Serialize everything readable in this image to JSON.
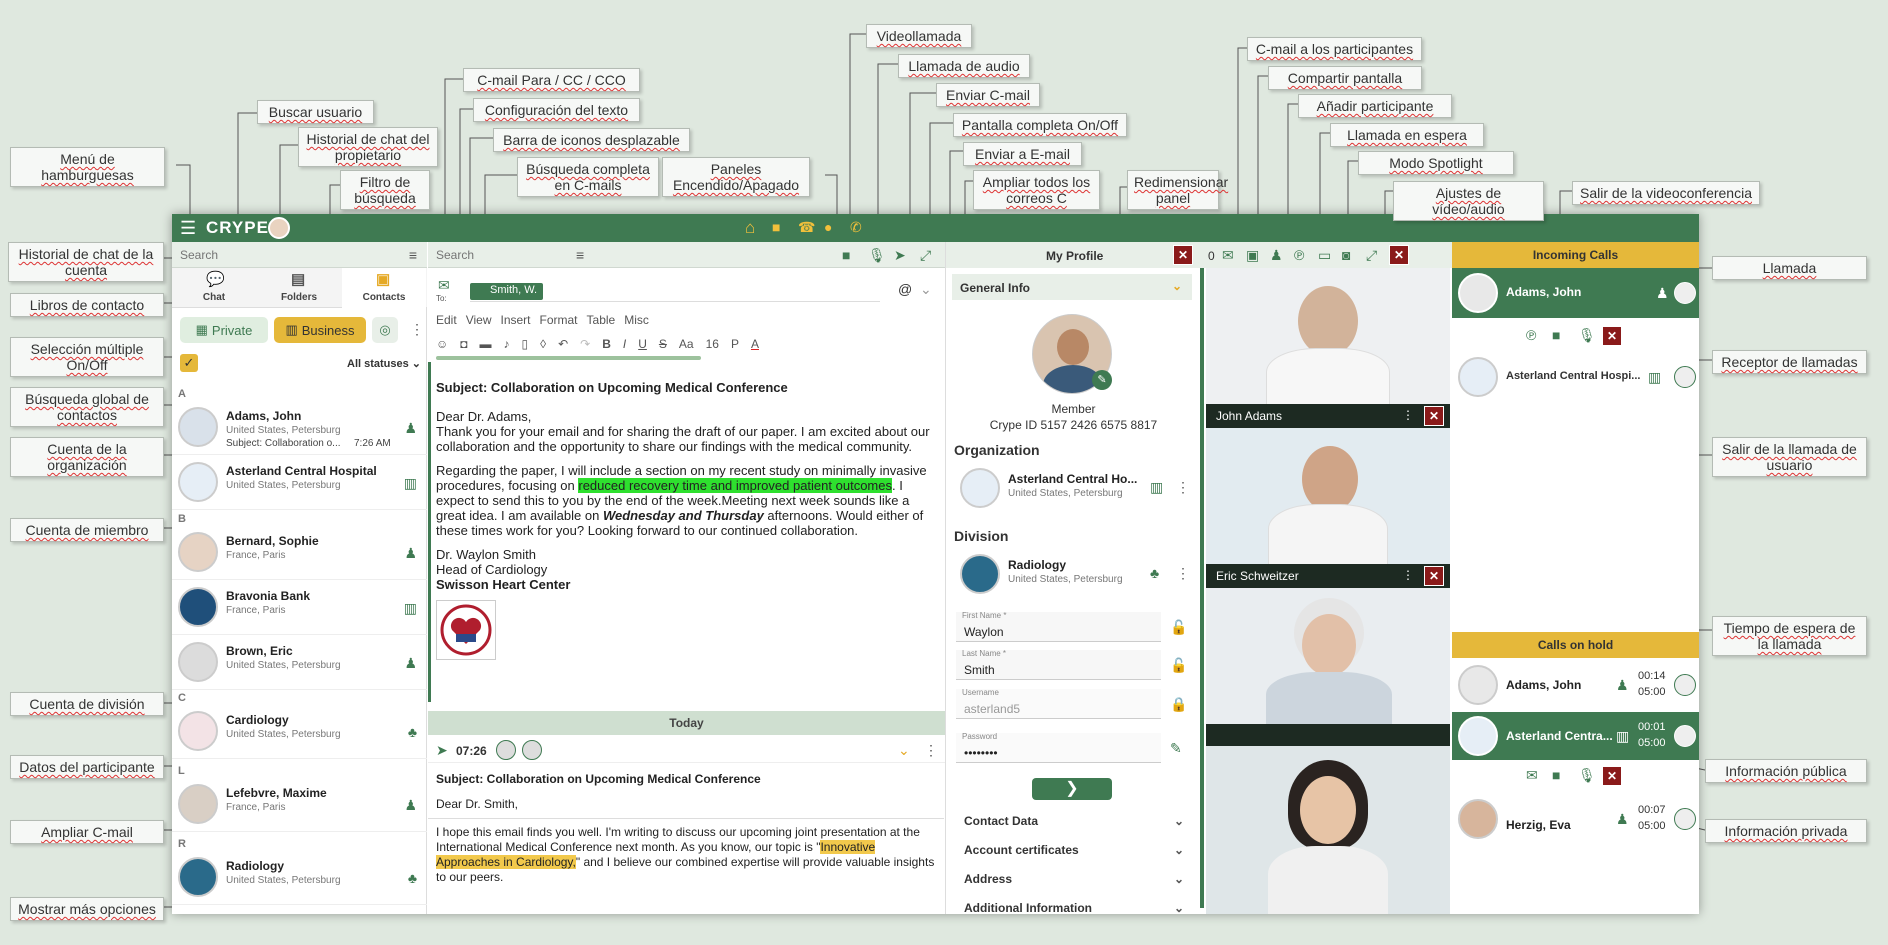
{
  "app": {
    "logo": "CRYPE",
    "left_search_placeholder": "Search",
    "mid_search_placeholder": "Search",
    "tabs": [
      "Chat",
      "Folders",
      "Contacts"
    ],
    "filters": {
      "private": "Private",
      "business": "Business",
      "statuses": "All statuses"
    },
    "sections": [
      "A",
      "B",
      "C",
      "L",
      "R"
    ],
    "contacts": [
      {
        "name": "Adams, John",
        "location": "United States, Petersburg",
        "preview": "Subject: Collaboration o...",
        "time": "7:26 AM",
        "type": "person-icon"
      },
      {
        "name": "Asterland Central Hospital",
        "location": "United States, Petersburg",
        "type": "organization-icon"
      },
      {
        "name": "Bernard, Sophie",
        "location": "France, Paris",
        "type": "person-icon"
      },
      {
        "name": "Bravonia Bank",
        "location": "France, Paris",
        "type": "organization-icon"
      },
      {
        "name": "Brown, Eric",
        "location": "United States, Petersburg",
        "type": "person-icon"
      },
      {
        "name": "Cardiology",
        "location": "United States, Petersburg",
        "type": "division-icon"
      },
      {
        "name": "Lefebvre, Maxime",
        "location": "France, Paris",
        "type": "person-icon"
      },
      {
        "name": "Radiology",
        "location": "United States, Petersburg",
        "type": "division-icon"
      }
    ],
    "compose": {
      "to_label": "To:",
      "recipient": "Smith, W.",
      "menus": [
        "Edit",
        "View",
        "Insert",
        "Format",
        "Table",
        "Misc"
      ],
      "font_size": "16",
      "paragraph": "P",
      "subject": "Subject: Collaboration on Upcoming Medical Conference",
      "greeting": "Dear Dr. Adams,",
      "p1": "Thank you for your email and for sharing the draft of our paper. I am excited about our collaboration and the opportunity to share our findings with the medical community.",
      "p2_a": "Regarding the paper, I will include a section on my recent study on minimally invasive procedures, focusing on ",
      "p2_hl": "reduced recovery time and improved patient outcomes",
      "p2_b": ". I expect to send this to you by the end of the week.Meeting next week sounds like a great idea. I am available on ",
      "p2_em": "Wednesday and Thursday",
      "p2_c": " afternoons. Would either of these times work for you? Looking forward to our continued collaboration.",
      "sig_name": "Dr. Waylon Smith",
      "sig_title": "Head of Cardiology",
      "sig_org": "Swisson Heart Center"
    },
    "thread": {
      "day": "Today",
      "time": "07:26",
      "subject": "Subject: Collaboration on Upcoming Medical Conference",
      "greeting": "Dear Dr. Smith,",
      "body_a": "I hope this email finds you well. I'm writing to discuss our upcoming joint presentation at the International Medical Conference next month. As you know, our topic is \"",
      "body_hl": "Innovative Approaches in Cardiology,",
      "body_b": "\" and I believe our combined expertise will provide valuable insights to our peers."
    },
    "profile": {
      "title": "My Profile",
      "section": "General Info",
      "role": "Member",
      "crype_id": "Crype ID 5157 2426 6575 8817",
      "org_heading": "Organization",
      "org_name": "Asterland Central Ho...",
      "org_loc": "United States, Petersburg",
      "div_heading": "Division",
      "div_name": "Radiology",
      "div_loc": "United States, Petersburg",
      "first_name_label": "First Name *",
      "first_name": "Waylon",
      "last_name_label": "Last Name *",
      "last_name": "Smith",
      "username_label": "Username",
      "username": "asterland5",
      "password_label": "Password",
      "password": "••••••••",
      "accordions": [
        "Contact Data",
        "Account certificates",
        "Address",
        "Additional Information"
      ]
    },
    "video": {
      "participant_count": "0",
      "tiles": [
        "John Adams",
        "Eric Schweitzer"
      ]
    },
    "calls": {
      "incoming_title": "Incoming Calls",
      "incoming_caller": "Adams, John",
      "incoming_receiver": "Asterland Central Hospi...",
      "hold_title": "Calls on hold",
      "hold": [
        {
          "name": "Adams, John",
          "t1": "00:14",
          "t2": "05:00"
        },
        {
          "name": "Asterland Centra...",
          "t1": "00:01",
          "t2": "05:00"
        },
        {
          "name": "Herzig, Eva",
          "t1": "00:07",
          "t2": "05:00"
        }
      ]
    }
  },
  "callouts": [
    "Menú de hamburguesas",
    "Buscar usuario",
    "Historial de chat del propietario",
    "Filtro de búsqueda",
    "C-mail Para / CC / CCO",
    "Configuración del texto",
    "Barra de iconos desplazable",
    "Búsqueda completa en C-mails",
    "Paneles Encendido/Apagado",
    "Videollamada",
    "Llamada de audio",
    "Enviar C-mail",
    "Pantalla completa On/Off",
    "Enviar a E-mail",
    "Ampliar todos los correos C",
    "Redimensionar panel",
    "C-mail a los participantes",
    "Compartir pantalla",
    "Añadir participante",
    "Llamada en espera",
    "Modo Spotlight",
    "Ajustes de vídeo/audio",
    "Salir de la videoconferencia",
    "Llamada",
    "Historial de chat de la cuenta",
    "Libros de contacto",
    "Selección múltiple On/Off",
    "Búsqueda global de contactos",
    "Cuenta de la organización",
    "Cuenta de miembro",
    "Receptor de llamadas",
    "Salir de la llamada de usuario",
    "Tiempo de espera de la llamada",
    "Cuenta de división",
    "Datos del participante",
    "Información pública",
    "Ampliar C-mail",
    "Información privada",
    "Mostrar más opciones"
  ],
  "colors": {
    "brand": "#3f7a52",
    "accent": "#e5b83a",
    "danger": "#8a1a1a",
    "highlight_green": "#2ee02e",
    "highlight_yellow": "#f2c94c"
  }
}
